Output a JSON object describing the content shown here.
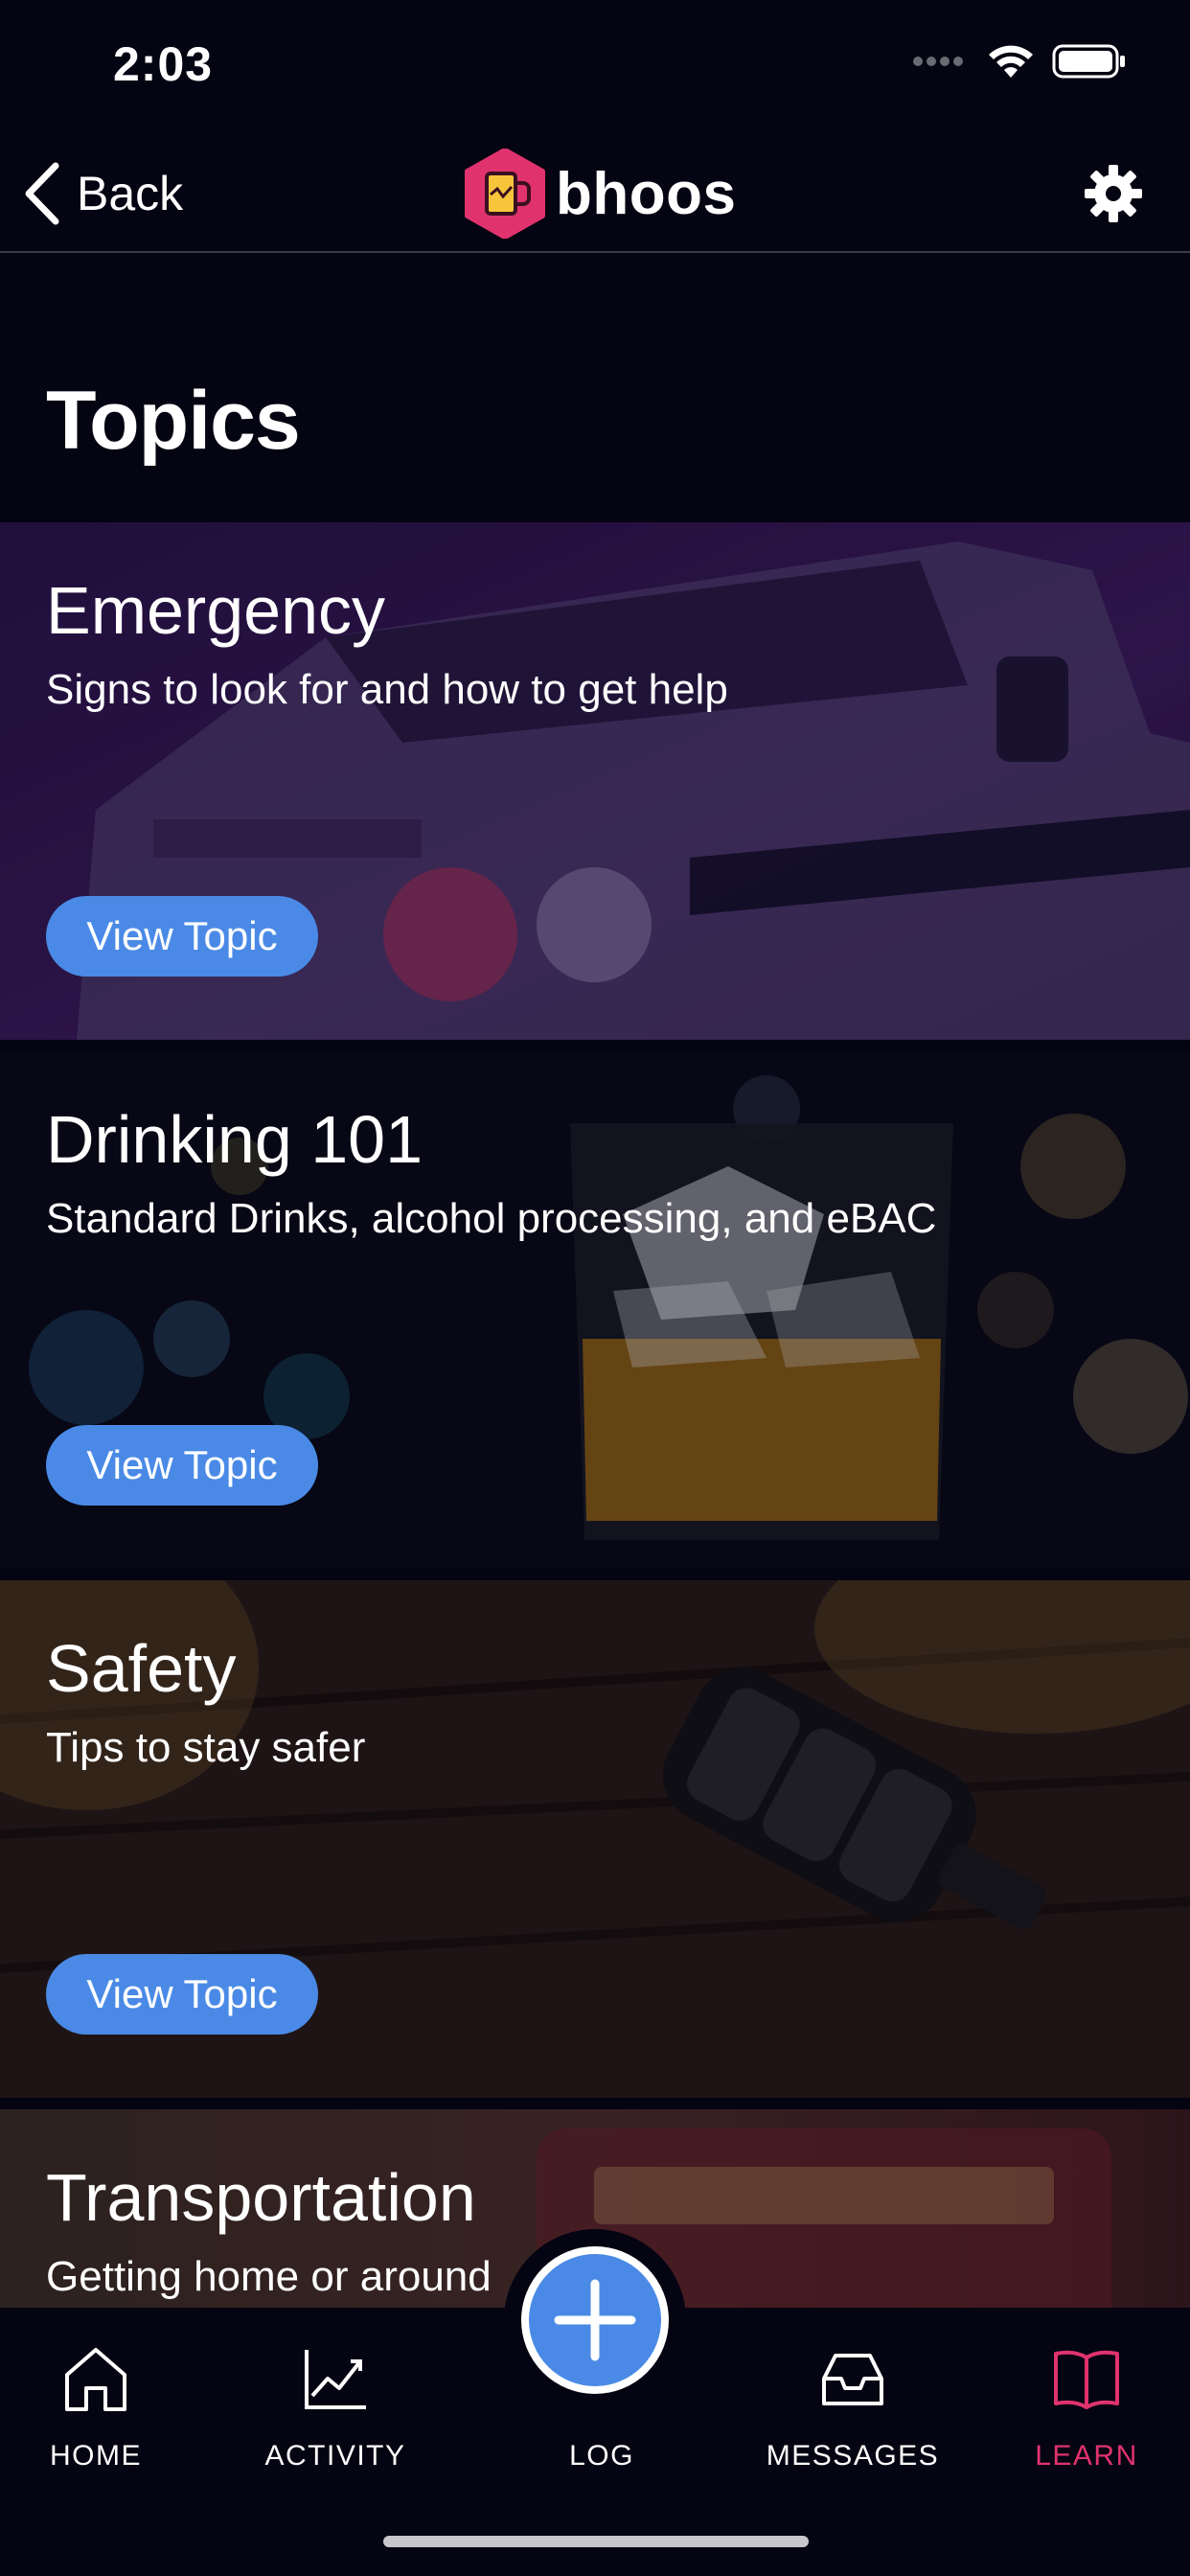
{
  "status_bar": {
    "time": "2:03"
  },
  "nav": {
    "back_label": "Back",
    "brand_name": "bhoos"
  },
  "page": {
    "title": "Topics"
  },
  "topics": [
    {
      "title": "Emergency",
      "description": "Signs to look for and how to get help",
      "button_label": "View Topic"
    },
    {
      "title": "Drinking 101",
      "description": "Standard Drinks, alcohol processing, and eBAC",
      "button_label": "View Topic"
    },
    {
      "title": "Safety",
      "description": "Tips to stay safer",
      "button_label": "View Topic"
    },
    {
      "title": "Transportation",
      "description": "Getting home or around"
    }
  ],
  "tab_bar": {
    "home": "HOME",
    "activity": "ACTIVITY",
    "log": "LOG",
    "messages": "MESSAGES",
    "learn": "LEARN"
  },
  "colors": {
    "accent": "#4a8ae6",
    "active_tab": "#e0336e",
    "background": "#040412",
    "brand": "#e0336e"
  },
  "icons": [
    "back-chevron-icon",
    "bhoos-logo-icon",
    "gear-icon",
    "home-icon",
    "activity-chart-icon",
    "plus-icon",
    "inbox-icon",
    "book-icon"
  ]
}
